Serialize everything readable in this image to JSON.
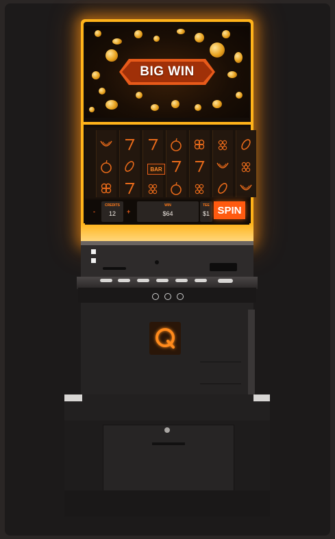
{
  "screen": {
    "banner": "BIG WIN"
  },
  "controls": {
    "credits_label": "CREDITS",
    "credits_value": "12",
    "minus": "-",
    "plus": "+",
    "win_label": "WIN",
    "win_value": "$64",
    "bet_label": "TEE",
    "bet_value": "$1",
    "spin_label": "SPIN"
  },
  "reels": {
    "bar_label": "BAR",
    "symbols": [
      [
        "watermelon-icon",
        "apple-icon",
        "clover-icon"
      ],
      [
        "seven-icon",
        "lemon-icon",
        "seven-icon"
      ],
      [
        "seven-icon",
        "bar",
        "grapes-icon"
      ],
      [
        "apple-icon",
        "seven-icon",
        "apple-icon"
      ],
      [
        "clover-icon",
        "seven-icon",
        "grapes-icon"
      ],
      [
        "grapes-icon",
        "watermelon-icon",
        "lemon-icon"
      ],
      [
        "lemon-icon",
        "grapes-icon",
        "watermelon-icon"
      ]
    ]
  },
  "colors": {
    "glow": "#ffb31a",
    "accent": "#ff5a10",
    "cabinet": "#252323"
  }
}
